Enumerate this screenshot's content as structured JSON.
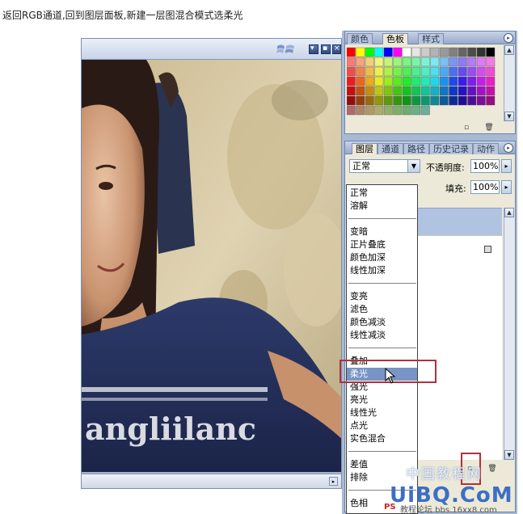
{
  "caption": "返回RGB通道,回到图层面板,新建一层图混合模式选柔光",
  "doc_window": {
    "photo_text": "angliilanc",
    "window_buttons": [
      "▾",
      "▪",
      "×"
    ]
  },
  "swatches_panel": {
    "tabs": [
      "颜色",
      "色板",
      "样式"
    ],
    "active_tab": "色板",
    "menu_icon": "▸",
    "scroll_up": "▲",
    "scroll_down": "▼",
    "new_icon": "▫",
    "trash_icon": "🗑"
  },
  "layers_panel": {
    "tabs": [
      "图层",
      "通道",
      "路径",
      "历史记录",
      "动作"
    ],
    "active_tab": "图层",
    "menu_icon": "▸",
    "blend_mode": "正常",
    "dropdown_arrow": "▼",
    "opacity_label": "不透明度:",
    "opacity_value": "100%",
    "fill_label": "填充:",
    "fill_value": "100%",
    "stepper_arrow": "▸",
    "scroll_up": "▲",
    "scroll_down": "▼",
    "new_layer_icon": "▫",
    "trash_icon": "🗑"
  },
  "blend_modes": {
    "groups": [
      [
        "正常",
        "溶解"
      ],
      [
        "变暗",
        "正片叠底",
        "颜色加深",
        "线性加深"
      ],
      [
        "变亮",
        "滤色",
        "颜色减淡",
        "线性减淡"
      ],
      [
        "叠加",
        "柔光",
        "强光",
        "亮光",
        "线性光",
        "点光",
        "实色混合"
      ],
      [
        "差值",
        "排除"
      ],
      [
        "色相"
      ]
    ],
    "highlighted": "柔光"
  },
  "watermark": {
    "main": "UiBQ.CoM",
    "small": "中国教程网",
    "ps": "PS",
    "url": "教程论坛 bbs.16xx8.com"
  },
  "colors": {
    "highlight": "#7794c4",
    "annotation_red": "#b0323c",
    "panel_bg": "#ece9d8",
    "watermark_blue": "#3c6fc4"
  }
}
